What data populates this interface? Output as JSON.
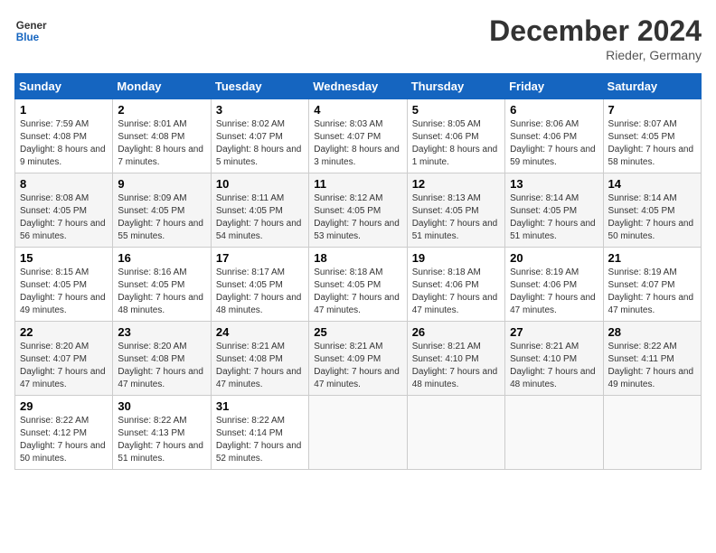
{
  "header": {
    "logo_general": "General",
    "logo_blue": "Blue",
    "month_title": "December 2024",
    "location": "Rieder, Germany"
  },
  "days_of_week": [
    "Sunday",
    "Monday",
    "Tuesday",
    "Wednesday",
    "Thursday",
    "Friday",
    "Saturday"
  ],
  "weeks": [
    [
      {
        "day": "1",
        "sunrise": "Sunrise: 7:59 AM",
        "sunset": "Sunset: 4:08 PM",
        "daylight": "Daylight: 8 hours and 9 minutes."
      },
      {
        "day": "2",
        "sunrise": "Sunrise: 8:01 AM",
        "sunset": "Sunset: 4:08 PM",
        "daylight": "Daylight: 8 hours and 7 minutes."
      },
      {
        "day": "3",
        "sunrise": "Sunrise: 8:02 AM",
        "sunset": "Sunset: 4:07 PM",
        "daylight": "Daylight: 8 hours and 5 minutes."
      },
      {
        "day": "4",
        "sunrise": "Sunrise: 8:03 AM",
        "sunset": "Sunset: 4:07 PM",
        "daylight": "Daylight: 8 hours and 3 minutes."
      },
      {
        "day": "5",
        "sunrise": "Sunrise: 8:05 AM",
        "sunset": "Sunset: 4:06 PM",
        "daylight": "Daylight: 8 hours and 1 minute."
      },
      {
        "day": "6",
        "sunrise": "Sunrise: 8:06 AM",
        "sunset": "Sunset: 4:06 PM",
        "daylight": "Daylight: 7 hours and 59 minutes."
      },
      {
        "day": "7",
        "sunrise": "Sunrise: 8:07 AM",
        "sunset": "Sunset: 4:05 PM",
        "daylight": "Daylight: 7 hours and 58 minutes."
      }
    ],
    [
      {
        "day": "8",
        "sunrise": "Sunrise: 8:08 AM",
        "sunset": "Sunset: 4:05 PM",
        "daylight": "Daylight: 7 hours and 56 minutes."
      },
      {
        "day": "9",
        "sunrise": "Sunrise: 8:09 AM",
        "sunset": "Sunset: 4:05 PM",
        "daylight": "Daylight: 7 hours and 55 minutes."
      },
      {
        "day": "10",
        "sunrise": "Sunrise: 8:11 AM",
        "sunset": "Sunset: 4:05 PM",
        "daylight": "Daylight: 7 hours and 54 minutes."
      },
      {
        "day": "11",
        "sunrise": "Sunrise: 8:12 AM",
        "sunset": "Sunset: 4:05 PM",
        "daylight": "Daylight: 7 hours and 53 minutes."
      },
      {
        "day": "12",
        "sunrise": "Sunrise: 8:13 AM",
        "sunset": "Sunset: 4:05 PM",
        "daylight": "Daylight: 7 hours and 51 minutes."
      },
      {
        "day": "13",
        "sunrise": "Sunrise: 8:14 AM",
        "sunset": "Sunset: 4:05 PM",
        "daylight": "Daylight: 7 hours and 51 minutes."
      },
      {
        "day": "14",
        "sunrise": "Sunrise: 8:14 AM",
        "sunset": "Sunset: 4:05 PM",
        "daylight": "Daylight: 7 hours and 50 minutes."
      }
    ],
    [
      {
        "day": "15",
        "sunrise": "Sunrise: 8:15 AM",
        "sunset": "Sunset: 4:05 PM",
        "daylight": "Daylight: 7 hours and 49 minutes."
      },
      {
        "day": "16",
        "sunrise": "Sunrise: 8:16 AM",
        "sunset": "Sunset: 4:05 PM",
        "daylight": "Daylight: 7 hours and 48 minutes."
      },
      {
        "day": "17",
        "sunrise": "Sunrise: 8:17 AM",
        "sunset": "Sunset: 4:05 PM",
        "daylight": "Daylight: 7 hours and 48 minutes."
      },
      {
        "day": "18",
        "sunrise": "Sunrise: 8:18 AM",
        "sunset": "Sunset: 4:05 PM",
        "daylight": "Daylight: 7 hours and 47 minutes."
      },
      {
        "day": "19",
        "sunrise": "Sunrise: 8:18 AM",
        "sunset": "Sunset: 4:06 PM",
        "daylight": "Daylight: 7 hours and 47 minutes."
      },
      {
        "day": "20",
        "sunrise": "Sunrise: 8:19 AM",
        "sunset": "Sunset: 4:06 PM",
        "daylight": "Daylight: 7 hours and 47 minutes."
      },
      {
        "day": "21",
        "sunrise": "Sunrise: 8:19 AM",
        "sunset": "Sunset: 4:07 PM",
        "daylight": "Daylight: 7 hours and 47 minutes."
      }
    ],
    [
      {
        "day": "22",
        "sunrise": "Sunrise: 8:20 AM",
        "sunset": "Sunset: 4:07 PM",
        "daylight": "Daylight: 7 hours and 47 minutes."
      },
      {
        "day": "23",
        "sunrise": "Sunrise: 8:20 AM",
        "sunset": "Sunset: 4:08 PM",
        "daylight": "Daylight: 7 hours and 47 minutes."
      },
      {
        "day": "24",
        "sunrise": "Sunrise: 8:21 AM",
        "sunset": "Sunset: 4:08 PM",
        "daylight": "Daylight: 7 hours and 47 minutes."
      },
      {
        "day": "25",
        "sunrise": "Sunrise: 8:21 AM",
        "sunset": "Sunset: 4:09 PM",
        "daylight": "Daylight: 7 hours and 47 minutes."
      },
      {
        "day": "26",
        "sunrise": "Sunrise: 8:21 AM",
        "sunset": "Sunset: 4:10 PM",
        "daylight": "Daylight: 7 hours and 48 minutes."
      },
      {
        "day": "27",
        "sunrise": "Sunrise: 8:21 AM",
        "sunset": "Sunset: 4:10 PM",
        "daylight": "Daylight: 7 hours and 48 minutes."
      },
      {
        "day": "28",
        "sunrise": "Sunrise: 8:22 AM",
        "sunset": "Sunset: 4:11 PM",
        "daylight": "Daylight: 7 hours and 49 minutes."
      }
    ],
    [
      {
        "day": "29",
        "sunrise": "Sunrise: 8:22 AM",
        "sunset": "Sunset: 4:12 PM",
        "daylight": "Daylight: 7 hours and 50 minutes."
      },
      {
        "day": "30",
        "sunrise": "Sunrise: 8:22 AM",
        "sunset": "Sunset: 4:13 PM",
        "daylight": "Daylight: 7 hours and 51 minutes."
      },
      {
        "day": "31",
        "sunrise": "Sunrise: 8:22 AM",
        "sunset": "Sunset: 4:14 PM",
        "daylight": "Daylight: 7 hours and 52 minutes."
      },
      null,
      null,
      null,
      null
    ]
  ]
}
